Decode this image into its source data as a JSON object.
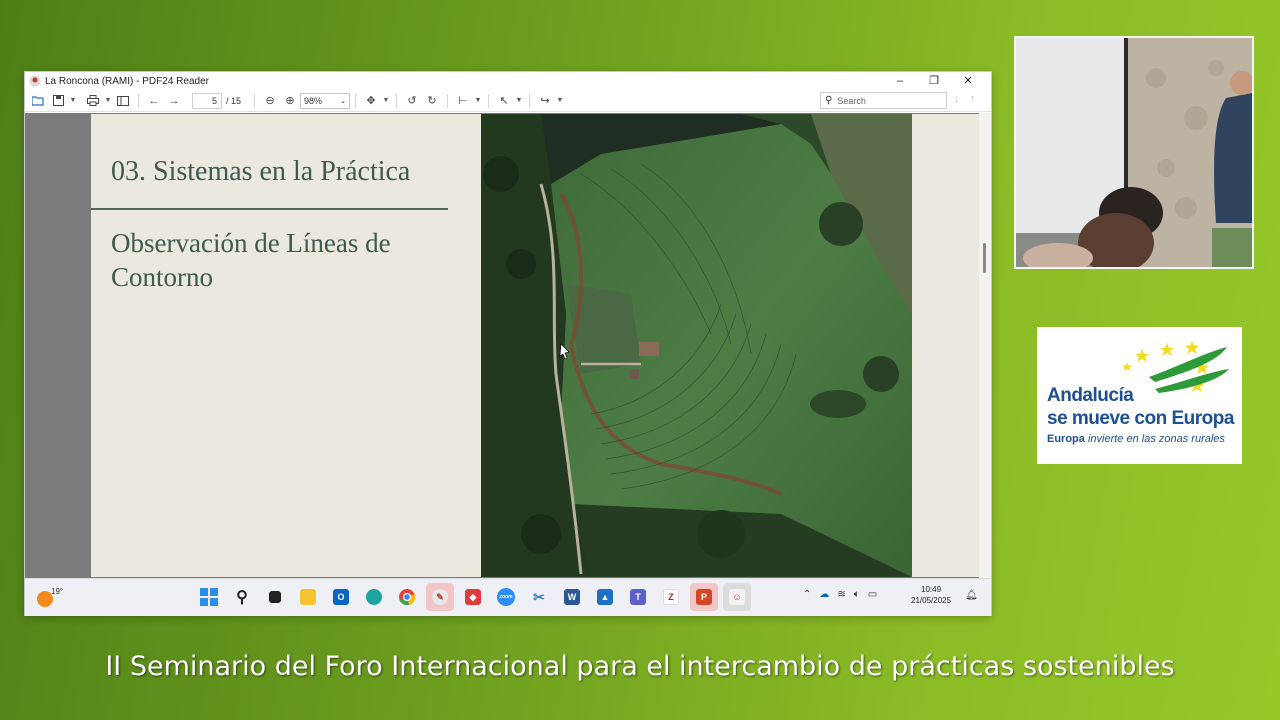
{
  "window": {
    "title": "La Roncona (RAMI) - PDF24 Reader",
    "controls": {
      "minimize": "–",
      "maximize": "❐",
      "close": "✕"
    }
  },
  "toolbar": {
    "page_current": "5",
    "page_total": "/ 15",
    "zoom": "98%",
    "search_placeholder": "Search"
  },
  "slide": {
    "section_title": "03. Sistemas en la Práctica",
    "subtitle": "Observación de Líneas de Contorno"
  },
  "taskbar": {
    "temperature": "19°",
    "apps": [
      "start",
      "search",
      "task-view",
      "file-explorer",
      "outlook",
      "edge",
      "chrome",
      "pdf24",
      "anydesk",
      "zoom",
      "snipping-tool",
      "word",
      "paint",
      "teams",
      "filezilla",
      "powerpoint",
      "pdf24-reader"
    ],
    "zoom_label": "zoom",
    "time": "10:49",
    "date": "21/05/2025"
  },
  "logo": {
    "line1": "Andalucía",
    "line2": "se mueve con Europa",
    "line3_bold": "Europa",
    "line3_italic": "invierte en las zonas rurales",
    "colors": {
      "blue": "#1d4f93",
      "green": "#2e9a3a",
      "yellow": "#f2dc1e"
    }
  },
  "caption": "II Seminario del Foro Internacional para el intercambio de prácticas sostenibles"
}
